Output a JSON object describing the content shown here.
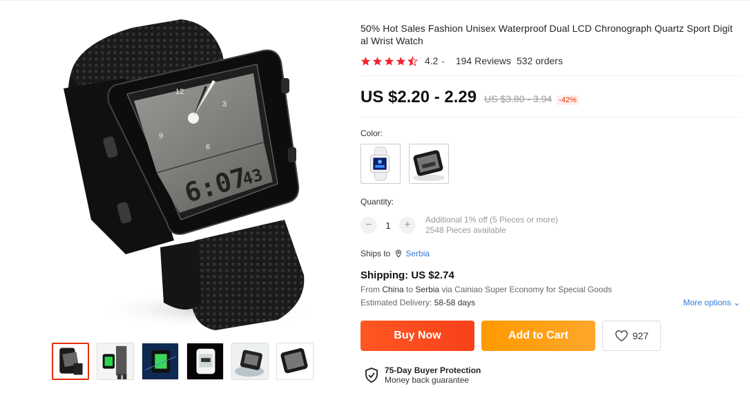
{
  "product": {
    "title": "50% Hot Sales Fashion Unisex Waterproof Dual LCD Chronograph Quartz Sport Digit al Wrist Watch",
    "rating": "4.2",
    "reviews": "194 Reviews",
    "orders": "532 orders",
    "price": "US $2.20 - 2.29",
    "old_price": "US $3.80 - 3.94",
    "discount": "-42%"
  },
  "gallery": {
    "main_image": "black-rectangular-watch",
    "lcd_time": "6:07",
    "lcd_seconds": "43",
    "dial_numbers": [
      "12",
      "3",
      "6",
      "9"
    ],
    "thumbnail_count": 6,
    "active_thumbnail": 1
  },
  "color": {
    "label": "Color:",
    "options": [
      "white-watch",
      "black-watch"
    ]
  },
  "quantity": {
    "label": "Quantity:",
    "minus": "−",
    "value": "1",
    "plus": "+",
    "discount_note": "Additional 1% off (5 Pieces or more)",
    "available": "2548 Pieces available"
  },
  "shipping": {
    "ships_to_label": "Ships to",
    "ships_to_country": "Serbia",
    "cost": "Shipping: US $2.74",
    "from_prefix": "From",
    "from_country": "China",
    "to_word": "to",
    "to_country": "Serbia",
    "via_text": "via Cainiao Super Economy for Special Goods",
    "delivery_label": "Estimated Delivery:",
    "delivery_value": "58-58 days",
    "more_options": "More options"
  },
  "actions": {
    "buy_now": "Buy Now",
    "add_to_cart": "Add to Cart",
    "wishlist_count": "927"
  },
  "protection": {
    "title": "75-Day Buyer Protection",
    "subtitle": "Money back guarantee"
  },
  "colors": {
    "star": "#f5222d",
    "accent_red": "#e62e04",
    "buy_now": "#f7411a",
    "add_to_cart": "#ff9a00",
    "link": "#2e7bd6"
  }
}
